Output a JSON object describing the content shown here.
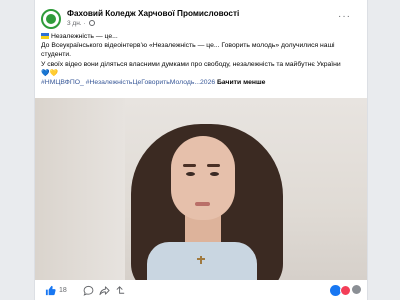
{
  "post": {
    "page_name": "Фаховий Коледж Харчової Промисловості",
    "time": "3 дн.",
    "more_label": "···",
    "text": {
      "line1": "Незалежність — це...",
      "line2": "До Всеукраїнського відеоінтерв’ю «Незалежність — це... Говорить молодь» долучилися наші",
      "line3": "студенти.",
      "line4": "У своїх відео вони діляться власними думками про свободу, незалежність та майбутнє України",
      "hearts_blue": "💙",
      "hearts_yellow": "💛",
      "hashtag1": "#НМЦВФПО_",
      "hashtag2": "#НезалежністьЦеГоворитьМолодь...2026",
      "see_less": "Бачити менше"
    },
    "likes_count": "18"
  },
  "colors": {
    "accent": "#1877f2",
    "hashtag": "#385898",
    "love": "#f33e58",
    "logo_green": "#2f9b3a"
  },
  "icons": [
    "flag-ukraine-icon",
    "globe-icon",
    "more-icon",
    "like-icon",
    "comment-icon",
    "share-icon",
    "repost-icon",
    "like-reaction-icon",
    "love-reaction-icon"
  ]
}
